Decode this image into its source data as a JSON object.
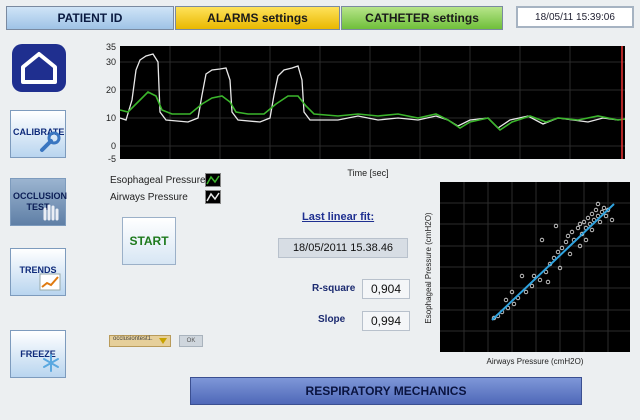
{
  "tabs": {
    "patient": "PATIENT ID",
    "alarms": "ALARMS settings",
    "catheter": "CATHETER settings"
  },
  "clock": "18/05/11 15:39:06",
  "sidebar": {
    "calibrate": "CALIBRATE",
    "occlusion": "OCCLUSION TEST",
    "trends": "TRENDS",
    "freeze": "FREEZE"
  },
  "waveform": {
    "x_label": "Time [sec]",
    "y_ticks": [
      "35",
      "30",
      "20",
      "10",
      "0",
      "-5"
    ]
  },
  "legend": {
    "esophageal": "Esophageal Pressure",
    "airways": "Airways Pressure"
  },
  "start_label": "START",
  "fit": {
    "title": "Last linear fit:",
    "date": "18/05/2011 15.38.46",
    "rsq_label": "R-square",
    "rsq_value": "0,904",
    "slope_label": "Slope",
    "slope_value": "0,994"
  },
  "select_value": "occlusiontest1.",
  "ok_label": "OK",
  "scatter": {
    "x_label": "Airways Pressure (cmH2O)",
    "y_label": "Esophageal Pressure (cmH2O)"
  },
  "bottom_button": "RESPIRATORY MECHANICS",
  "colors": {
    "esophageal": "#3bb52c",
    "airways": "#e8e8e8",
    "fit_line": "#2fa3df",
    "plot_bg": "#000000"
  }
}
